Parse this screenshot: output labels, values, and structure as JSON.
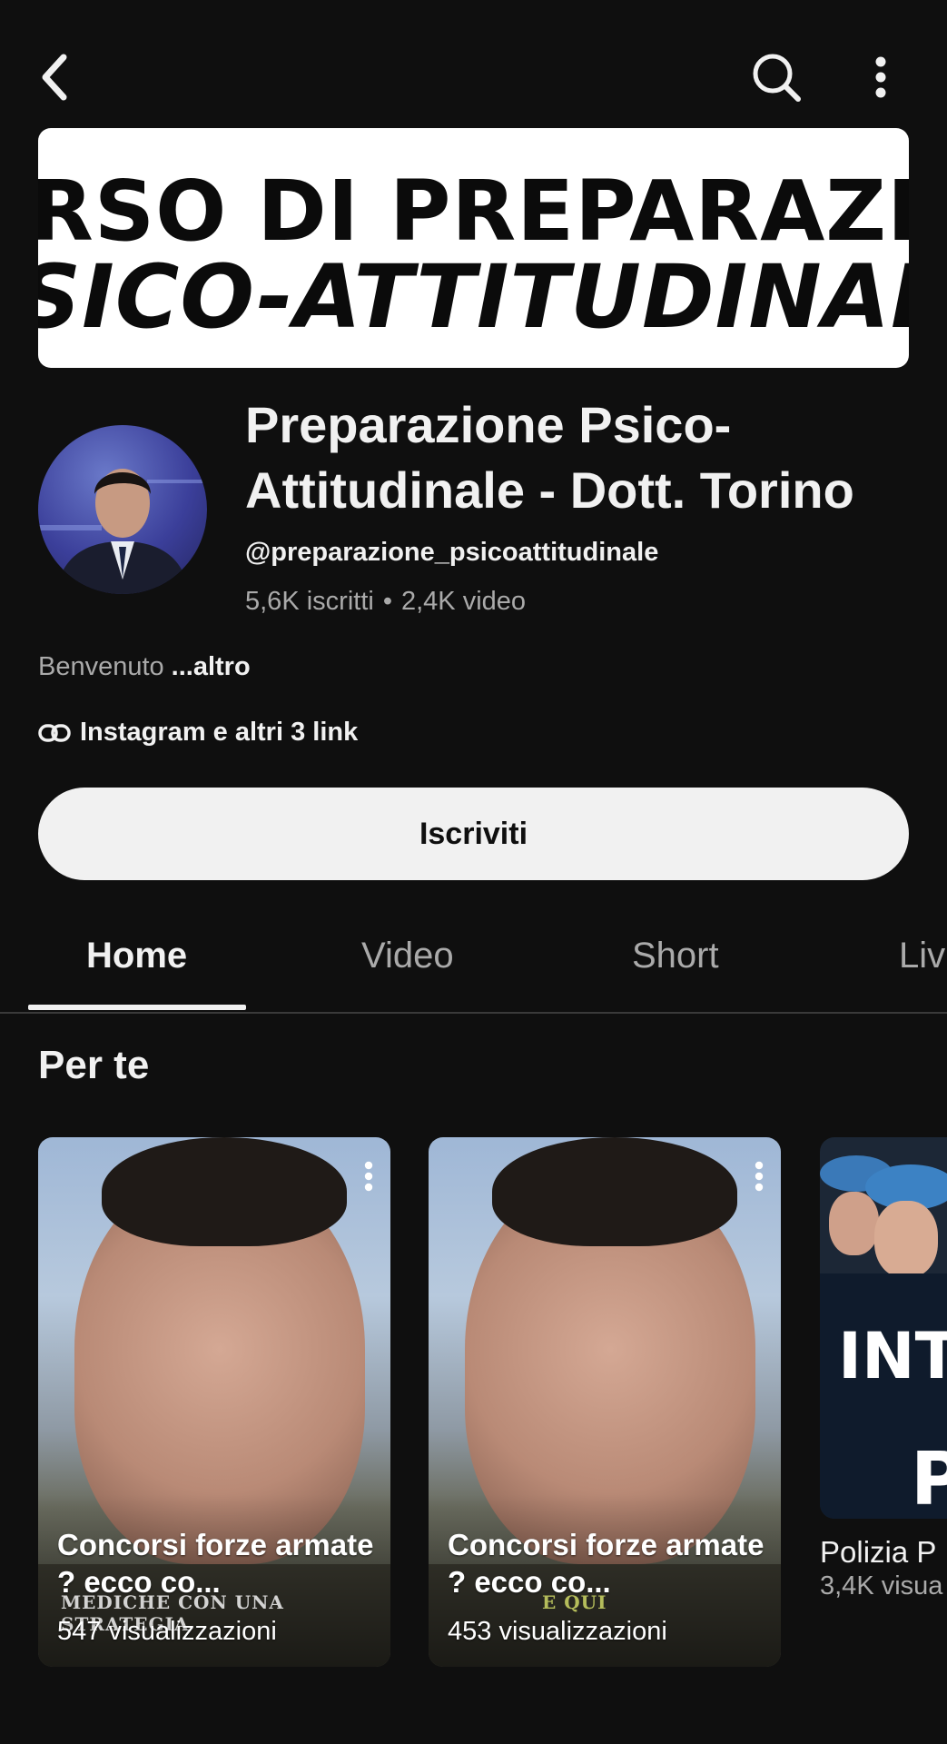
{
  "banner": {
    "line1": "RSO DI PREPARAZIO",
    "line2": "SICO-ATTITUDINAL"
  },
  "channel": {
    "title": "Preparazione Psico-Attitudinale - Dott. Torino",
    "handle": "@preparazione_psicoattitudinale",
    "subscribers": "5,6K iscritti",
    "separator": "•",
    "videos": "2,4K video",
    "description": "Benvenuto",
    "description_more": "...altro",
    "links": "Instagram e altri 3 link",
    "subscribe_label": "Iscriviti"
  },
  "tabs": [
    {
      "label": "Home",
      "active": true
    },
    {
      "label": "Video",
      "active": false
    },
    {
      "label": "Short",
      "active": false
    },
    {
      "label": "Liv",
      "active": false
    }
  ],
  "section": {
    "title": "Per te"
  },
  "shorts": [
    {
      "title": "Concorsi forze armate ? ecco co...",
      "views": "547 visualizzazioni",
      "caption": "MEDICHE CON UNA STRATEGIA"
    },
    {
      "title": "Concorsi forze armate ? ecco co...",
      "views": "453 visualizzazioni",
      "caption": "E QUI"
    },
    {
      "title": "Polizia P",
      "views": "3,4K visua",
      "thumb_text1": "INTE",
      "thumb_text2": "P"
    }
  ],
  "icons": {
    "back": "back-arrow-icon",
    "search": "search-icon",
    "more": "more-vert-icon",
    "link": "link-icon"
  },
  "colors": {
    "background": "#0f0f0f",
    "text": "#f1f1f1",
    "secondary_text": "#aaaaaa",
    "subscribe_bg": "#f1f1f1"
  }
}
